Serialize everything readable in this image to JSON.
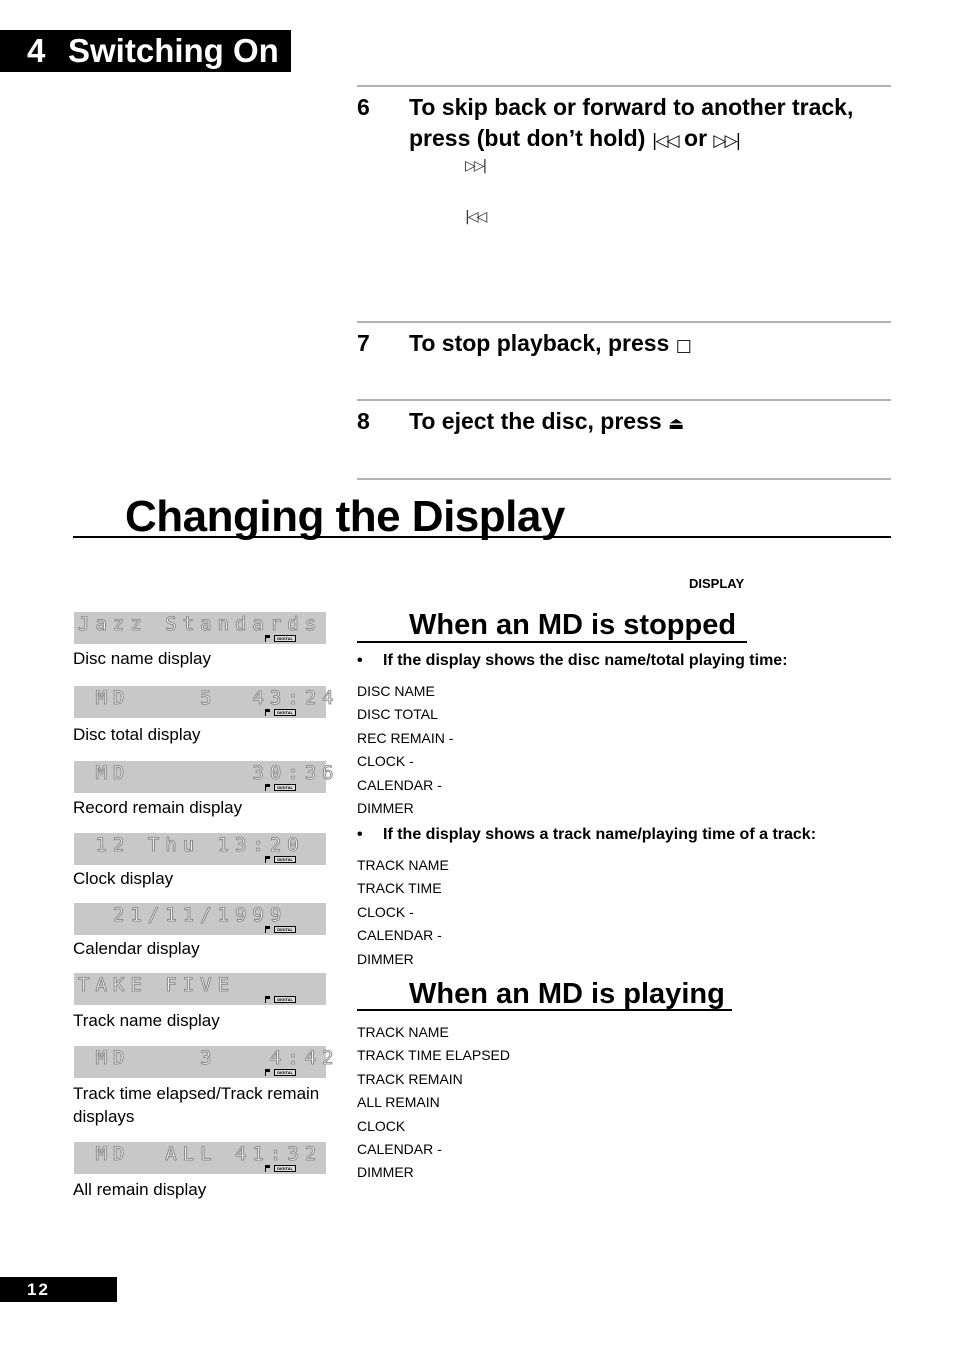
{
  "chapter": {
    "number": "4",
    "title": "Switching On"
  },
  "steps": [
    {
      "number": "6",
      "text": "To skip back or forward to another track, press (but don’t hold)",
      "icon_a": "⏮",
      "joiner": "or",
      "icon_b": "⏭",
      "sub_icons": [
        "next-track-icon",
        "previous-track-icon"
      ]
    },
    {
      "number": "7",
      "text": "To stop playback, press",
      "icon": "stop-icon"
    },
    {
      "number": "8",
      "text": "To eject the disc, press",
      "icon": "eject-icon"
    }
  ],
  "section": {
    "title": "Changing the Display",
    "button_label": "DISPLAY"
  },
  "lcd_displays": [
    {
      "screen": "Jazz Standards",
      "badge": "DIGITAL",
      "caption": "Disc name display"
    },
    {
      "screen": " MD    5  43:24",
      "badge": "DIGITAL",
      "caption": "Disc total display"
    },
    {
      "screen": " MD       30:36",
      "badge": "DIGITAL",
      "caption": "Record remain display"
    },
    {
      "screen": " 12 Thu 13:20",
      "badge": "DIGITAL",
      "caption": "Clock display"
    },
    {
      "screen": "  21/11/1999",
      "badge": "DIGITAL",
      "caption": "Calendar display"
    },
    {
      "screen": "TAKE FIVE",
      "badge": "DIGITAL",
      "caption": "Track name display"
    },
    {
      "screen": " MD    3   4:42",
      "badge": "DIGITAL",
      "caption": "Track time elapsed/Track remain displays"
    },
    {
      "screen": " MD  ALL 41:32",
      "badge": "DIGITAL",
      "caption": "All remain display"
    }
  ],
  "stopped": {
    "title": "When an MD is stopped",
    "groups": [
      {
        "bullet": "•",
        "heading": "If the display shows the disc name/total playing time:",
        "items": [
          "DISC NAME",
          "DISC TOTAL",
          "REC REMAIN -",
          "CLOCK -",
          "CALENDAR -",
          "DIMMER"
        ]
      },
      {
        "bullet": "•",
        "heading": "If the display shows a track name/playing time of a track:",
        "items": [
          "TRACK NAME",
          "TRACK TIME",
          "CLOCK -",
          "CALENDAR -",
          "DIMMER"
        ]
      }
    ]
  },
  "playing": {
    "title": "When an MD is playing",
    "items": [
      "TRACK NAME",
      "TRACK TIME ELAPSED",
      "TRACK REMAIN",
      "ALL REMAIN",
      "CLOCK",
      "CALENDAR -",
      "DIMMER"
    ]
  },
  "page_number": "12"
}
